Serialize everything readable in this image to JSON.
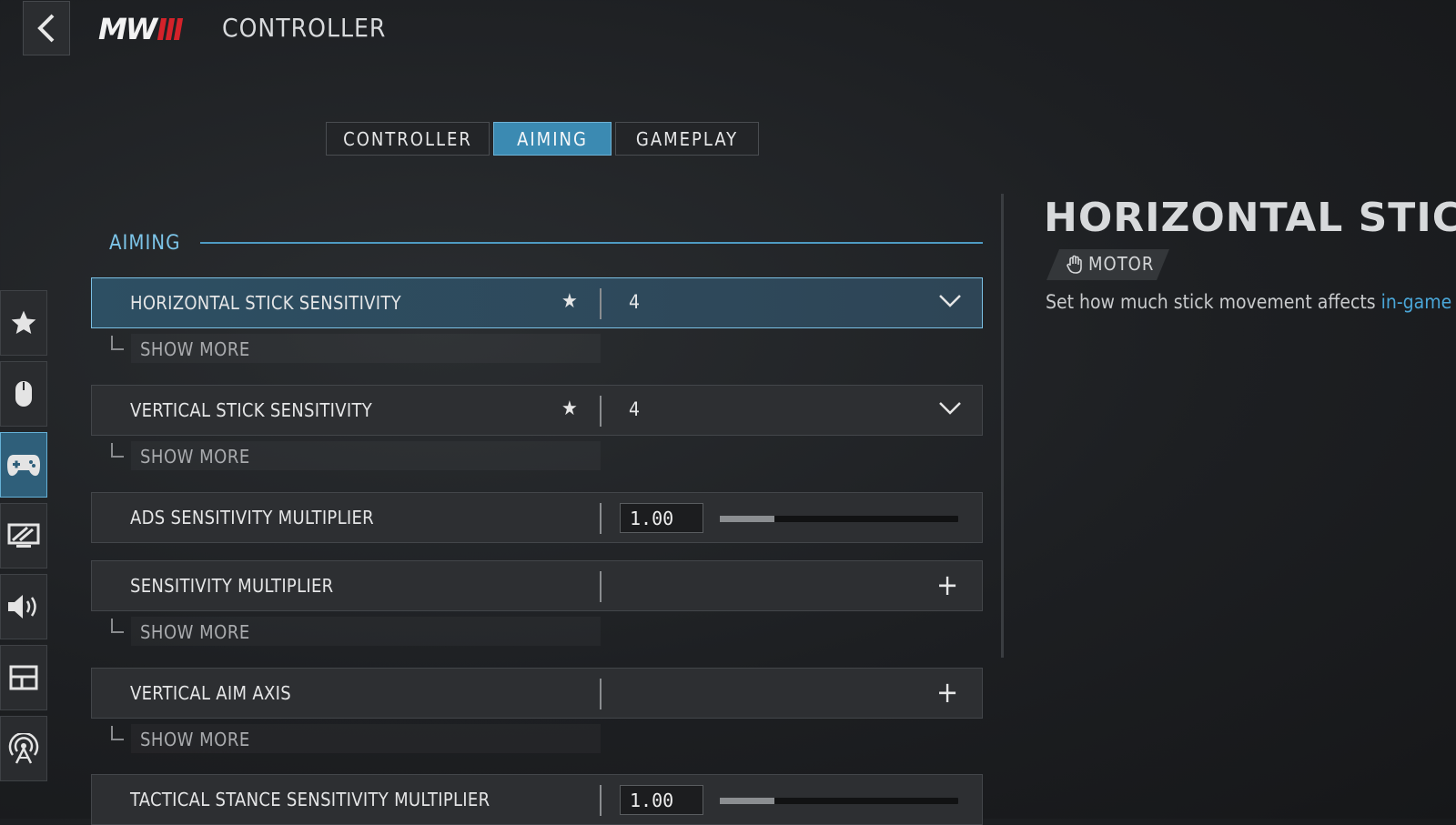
{
  "header": {
    "logo_text": "MW",
    "title": "CONTROLLER"
  },
  "tabs": [
    {
      "label": "CONTROLLER",
      "active": false
    },
    {
      "label": "AIMING",
      "active": true
    },
    {
      "label": "GAMEPLAY",
      "active": false
    }
  ],
  "sidebar": {
    "items": [
      {
        "icon": "star-icon",
        "active": false
      },
      {
        "icon": "mouse-icon",
        "active": false
      },
      {
        "icon": "gamepad-icon",
        "active": true
      },
      {
        "icon": "display-icon",
        "active": false
      },
      {
        "icon": "speaker-icon",
        "active": false
      },
      {
        "icon": "interface-icon",
        "active": false
      },
      {
        "icon": "network-icon",
        "active": false
      }
    ]
  },
  "section": {
    "title": "AIMING"
  },
  "settings": [
    {
      "label": "HORIZONTAL STICK SENSITIVITY",
      "value": "4",
      "show_more": "SHOW MORE"
    },
    {
      "label": "VERTICAL STICK SENSITIVITY",
      "value": "4",
      "show_more": "SHOW MORE"
    },
    {
      "label": "ADS SENSITIVITY MULTIPLIER",
      "value": "1.00",
      "slider_fraction": 0.23
    },
    {
      "label": "SENSITIVITY MULTIPLIER",
      "show_more": "SHOW MORE"
    },
    {
      "label": "VERTICAL AIM AXIS",
      "show_more": "SHOW MORE"
    },
    {
      "label": "TACTICAL STANCE SENSITIVITY MULTIPLIER",
      "value": "1.00",
      "slider_fraction": 0.23
    }
  ],
  "detail": {
    "title": "HORIZONTAL STICK",
    "badge": "MOTOR",
    "description": "Set how much stick movement affects ",
    "description_link": "in-game"
  },
  "colors": {
    "accent": "#3b8ab2",
    "accent_light": "#7cc4e8",
    "logo_red": "#d4222a"
  }
}
